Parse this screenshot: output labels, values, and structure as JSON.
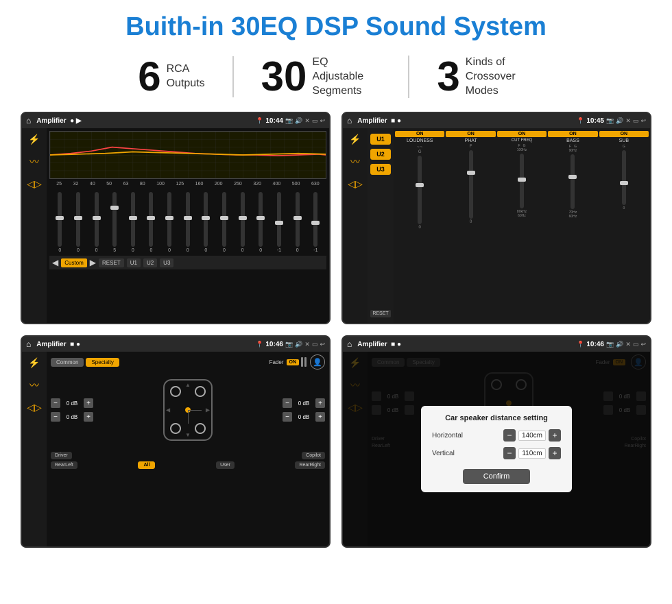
{
  "header": {
    "title": "Buith-in 30EQ DSP Sound System"
  },
  "stats": [
    {
      "number": "6",
      "label": "RCA\nOutputs"
    },
    {
      "number": "30",
      "label": "EQ Adjustable\nSegments"
    },
    {
      "number": "3",
      "label": "Kinds of\nCrossover Modes"
    }
  ],
  "screens": [
    {
      "id": "eq-screen",
      "statusBar": {
        "appName": "Amplifier",
        "time": "10:44"
      }
    },
    {
      "id": "amp-screen",
      "statusBar": {
        "appName": "Amplifier",
        "time": "10:45"
      }
    },
    {
      "id": "fader-screen",
      "statusBar": {
        "appName": "Amplifier",
        "time": "10:46"
      }
    },
    {
      "id": "dialog-screen",
      "statusBar": {
        "appName": "Amplifier",
        "time": "10:46"
      },
      "dialog": {
        "title": "Car speaker distance setting",
        "horizontalLabel": "Horizontal",
        "horizontalValue": "140cm",
        "verticalLabel": "Vertical",
        "verticalValue": "110cm",
        "confirmLabel": "Confirm"
      }
    }
  ],
  "eq": {
    "frequencies": [
      "25",
      "32",
      "40",
      "50",
      "63",
      "80",
      "100",
      "125",
      "160",
      "200",
      "250",
      "320",
      "400",
      "500",
      "630"
    ],
    "values": [
      "0",
      "0",
      "0",
      "5",
      "0",
      "0",
      "0",
      "0",
      "0",
      "0",
      "0",
      "0",
      "-1",
      "0",
      "-1"
    ],
    "presets": [
      "Custom",
      "RESET",
      "U1",
      "U2",
      "U3"
    ]
  },
  "amp": {
    "presets": [
      "U1",
      "U2",
      "U3"
    ],
    "channels": [
      {
        "header": "ON",
        "label": "LOUDNESS",
        "sliderPos": 60
      },
      {
        "header": "ON",
        "label": "PHAT",
        "sliderPos": 40
      },
      {
        "header": "ON",
        "label": "CUT FREQ",
        "sliderPos": 50
      },
      {
        "header": "ON",
        "label": "BASS",
        "sliderPos": 45
      },
      {
        "header": "ON",
        "label": "SUB",
        "sliderPos": 55
      }
    ],
    "resetLabel": "RESET"
  },
  "fader": {
    "tabs": [
      "Common",
      "Specialty"
    ],
    "faderLabel": "Fader",
    "onLabel": "ON",
    "dbValues": [
      "0 dB",
      "0 dB",
      "0 dB",
      "0 dB"
    ],
    "buttons": [
      "Driver",
      "Copilot",
      "RearLeft",
      "All",
      "User",
      "RearRight"
    ]
  },
  "dialog": {
    "title": "Car speaker distance setting",
    "horizontalLabel": "Horizontal",
    "horizontalValue": "140cm",
    "verticalLabel": "Vertical",
    "verticalValue": "110cm",
    "confirmLabel": "Confirm"
  },
  "colors": {
    "accent": "#f0a500",
    "background": "#111111",
    "text": "#ffffff",
    "blue": "#1a7fd4"
  }
}
